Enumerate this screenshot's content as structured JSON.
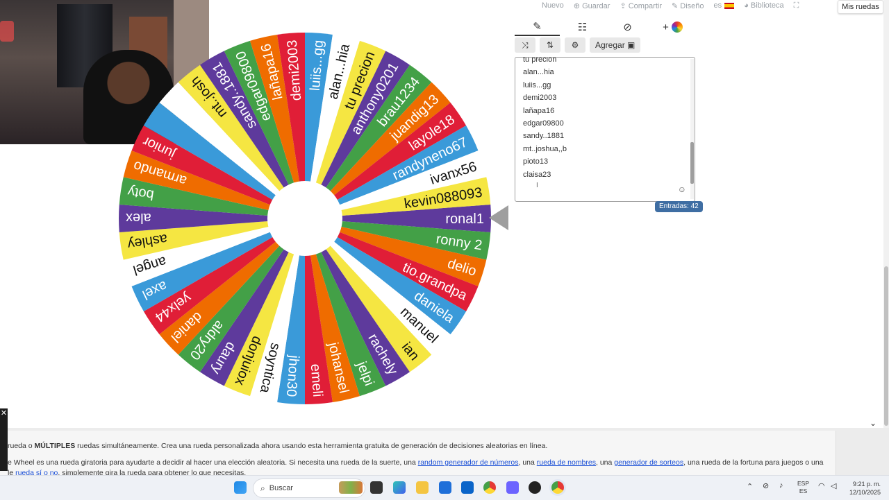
{
  "topnav": {
    "items": [
      "Nuevo",
      "Guardar",
      "Compartir",
      "Diseño",
      "es",
      "Biblioteca"
    ],
    "my_wheels": "Mis ruedas"
  },
  "editor": {
    "tabs": [
      "pencil-icon",
      "clipboard-icon",
      "eye-slash-icon",
      "add-wheel-icon"
    ],
    "add_tab_symbol": "+",
    "toolbar": {
      "add_label": "Agregar"
    },
    "visible_entries": [
      "tu precion",
      "alan...hia",
      "luiis...gg",
      "demi2003",
      "lañapa16",
      "edgar09800",
      "sandy..1881",
      "mt..joshua,,b",
      "pioto13",
      "claisa23"
    ],
    "entries_count": "Entradas: 42"
  },
  "wheel": {
    "segments": [
      {
        "label": "ronal1",
        "color": "#5e3a9c"
      },
      {
        "label": "ronny 2",
        "color": "#43a047"
      },
      {
        "label": "delio",
        "color": "#ef6c00"
      },
      {
        "label": "tio.grandpa",
        "color": "#e01e37"
      },
      {
        "label": "daniela",
        "color": "#3a9ad9"
      },
      {
        "label": "manuel",
        "color": "#ffffff"
      },
      {
        "label": "ian",
        "color": "#f5e642"
      },
      {
        "label": "rachely",
        "color": "#5e3a9c"
      },
      {
        "label": "jelpi",
        "color": "#43a047"
      },
      {
        "label": "johansel",
        "color": "#ef6c00"
      },
      {
        "label": "emeli",
        "color": "#e01e37"
      },
      {
        "label": "jhon30",
        "color": "#3a9ad9"
      },
      {
        "label": "soyntica",
        "color": "#ffffff"
      },
      {
        "label": "donjuiox",
        "color": "#f5e642"
      },
      {
        "label": "daury",
        "color": "#5e3a9c"
      },
      {
        "label": "aldry20",
        "color": "#43a047"
      },
      {
        "label": "daniel",
        "color": "#ef6c00"
      },
      {
        "label": "yelx44",
        "color": "#e01e37"
      },
      {
        "label": "axel",
        "color": "#3a9ad9"
      },
      {
        "label": "angel",
        "color": "#ffffff"
      },
      {
        "label": "ashley",
        "color": "#f5e642"
      },
      {
        "label": "alex",
        "color": "#5e3a9c"
      },
      {
        "label": "boty",
        "color": "#43a047"
      },
      {
        "label": "armando",
        "color": "#ef6c00"
      },
      {
        "label": "junior",
        "color": "#e01e37"
      },
      {
        "label": "",
        "color": "#3a9ad9"
      },
      {
        "label": "",
        "color": "#ffffff"
      },
      {
        "label": "mt..josh",
        "color": "#f5e642"
      },
      {
        "label": "sandy..1881",
        "color": "#5e3a9c"
      },
      {
        "label": "edgar09800",
        "color": "#43a047"
      },
      {
        "label": "lañapa16",
        "color": "#ef6c00"
      },
      {
        "label": "demi2003",
        "color": "#e01e37"
      },
      {
        "label": "luiis...gg",
        "color": "#3a9ad9"
      },
      {
        "label": "alan...hia",
        "color": "#ffffff"
      },
      {
        "label": "tu precion",
        "color": "#f5e642"
      },
      {
        "label": "anthony0201",
        "color": "#5e3a9c"
      },
      {
        "label": "brau1234",
        "color": "#43a047"
      },
      {
        "label": "juandig13",
        "color": "#ef6c00"
      },
      {
        "label": "layole18",
        "color": "#e01e37"
      },
      {
        "label": "randyneno67",
        "color": "#3a9ad9"
      },
      {
        "label": "ivanx56",
        "color": "#ffffff"
      },
      {
        "label": "kevin088093",
        "color": "#f5e642"
      }
    ]
  },
  "bottom": {
    "line1_prefix": "rueda o ",
    "line1_bold": "MÚLTIPLES",
    "line1_rest": " ruedas simultáneamente. Crea una rueda personalizada ahora usando esta herramienta gratuita de generación de decisiones aleatorias en línea.",
    "line2_a": "e Wheel es una rueda giratoria para ayudarte a decidir al hacer una elección aleatoria. Si necesita una rueda de la suerte, una ",
    "link1": "random generador de números",
    "line2_b": ", una ",
    "link2": "rueda de nombres",
    "line2_c": ", una ",
    "link3": "generador de sorteos",
    "line2_d": ", una rueda de la fortuna para juegos o una",
    "line3_a": "le ",
    "link4": "rueda sí o no",
    "line3_b": ", simplemente gira la rueda para obtener lo que necesitas."
  },
  "taskbar": {
    "search_placeholder": "Buscar",
    "lang_line1": "ESP",
    "lang_line2": "ES",
    "time": "9:21 p. m.",
    "date": "12/10/2025"
  }
}
